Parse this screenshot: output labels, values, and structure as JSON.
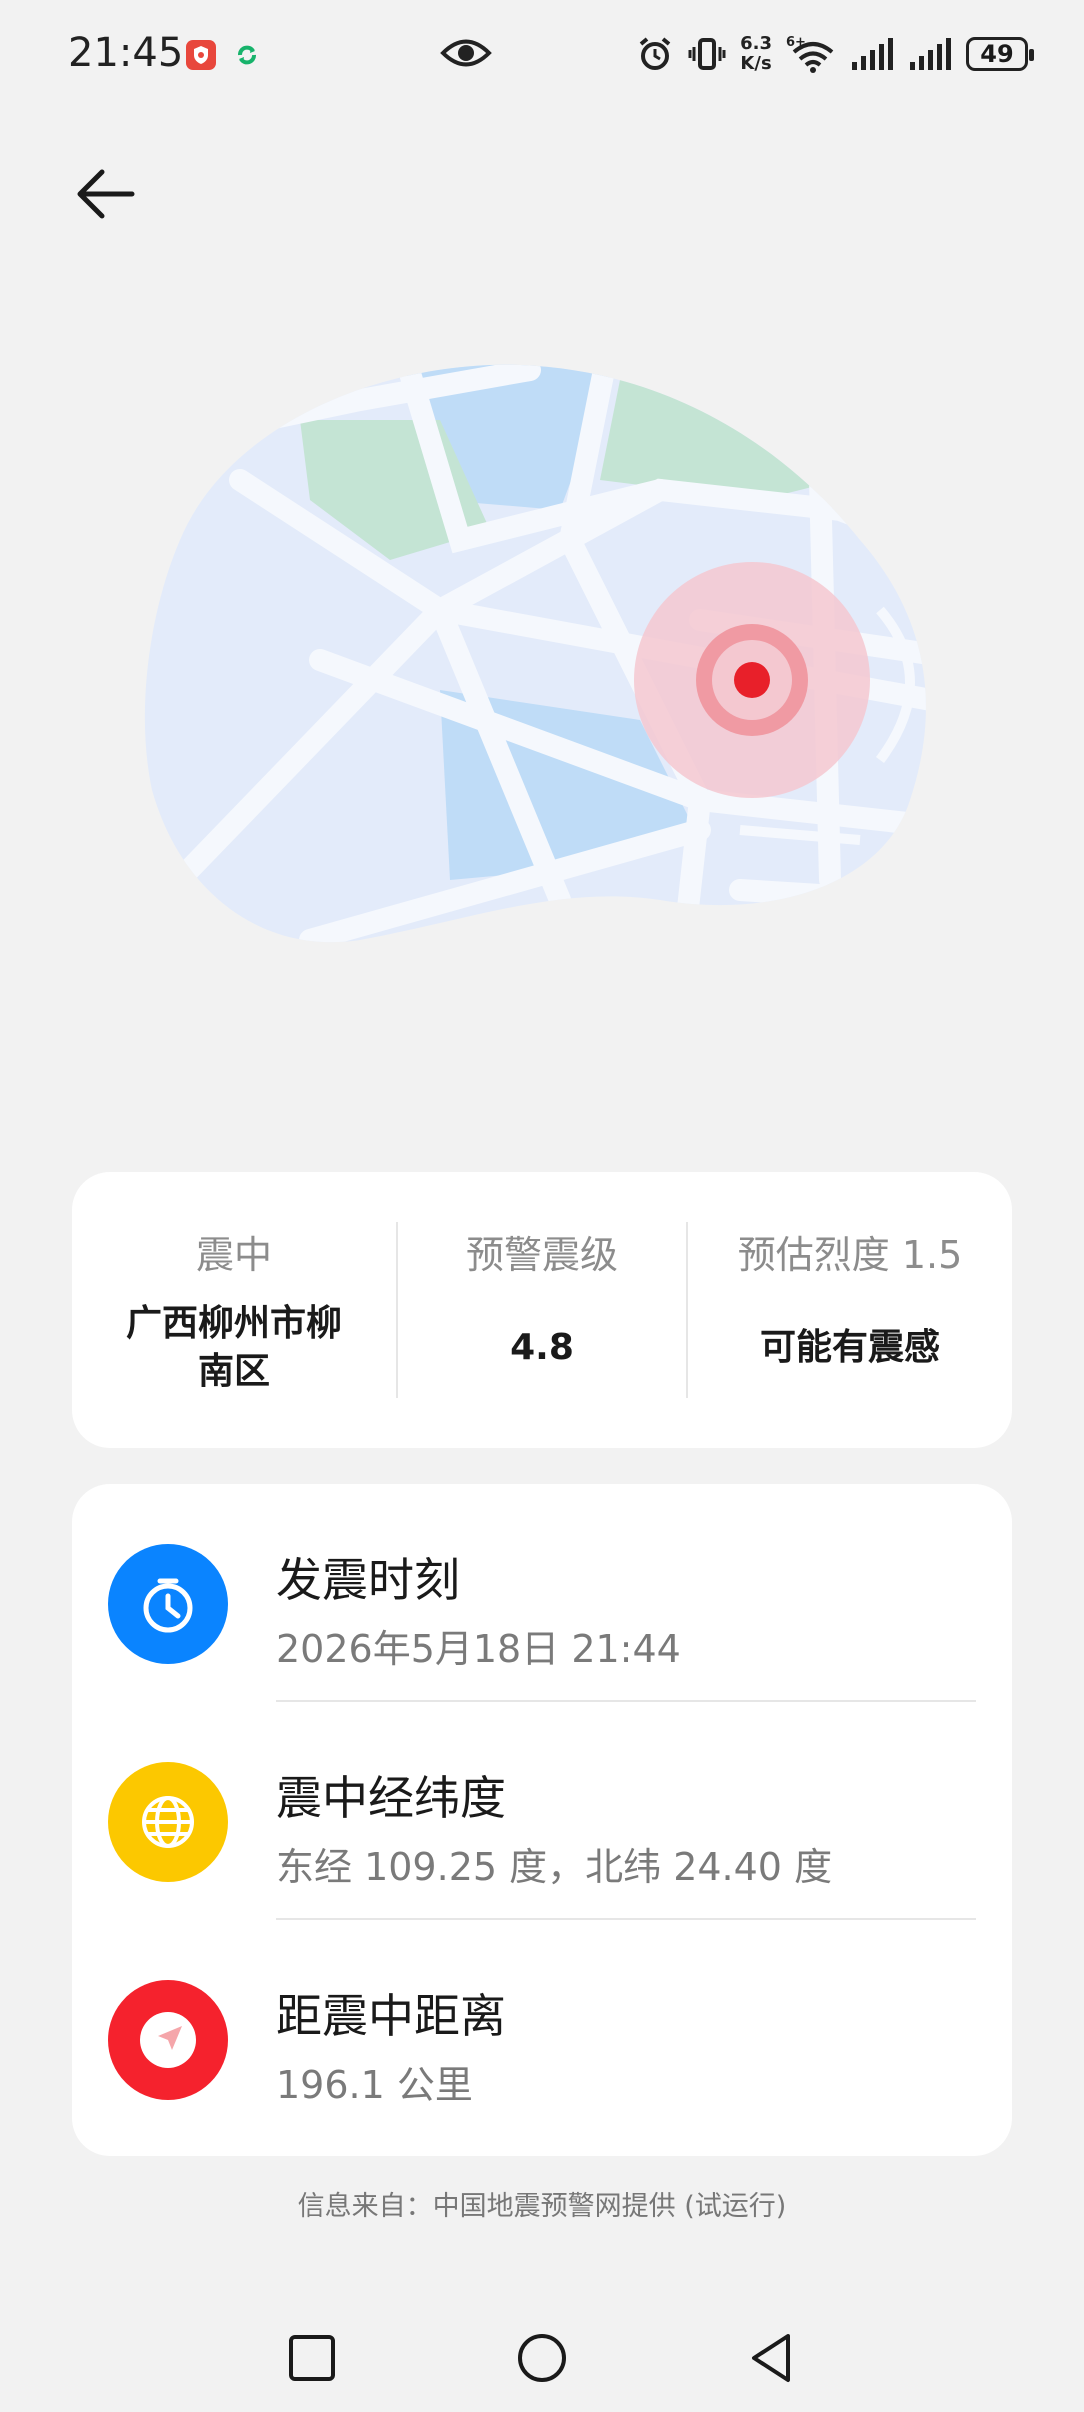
{
  "status_bar": {
    "time": "21:45",
    "net_speed_value": "6.3",
    "net_speed_unit": "K/s",
    "battery": "49",
    "icons": [
      "shield-app-icon",
      "sync-app-icon",
      "eye-icon",
      "alarm-icon",
      "vibrate-icon",
      "wifi-icon",
      "signal-icon",
      "signal-icon",
      "battery-icon"
    ]
  },
  "header": {
    "back_icon": "arrow-left-icon"
  },
  "summary": {
    "epicenter_label": "震中",
    "epicenter_value_line1": "广西柳州市柳",
    "epicenter_value_line2": "南区",
    "magnitude_label": "预警震级",
    "magnitude_value": "4.8",
    "intensity_label": "预估烈度 1.5",
    "intensity_value": "可能有震感"
  },
  "details": [
    {
      "icon": "clock-icon",
      "color": "#0a84ff",
      "title": "发震时刻",
      "value": "2026年5月18日 21:44"
    },
    {
      "icon": "globe-icon",
      "color": "#fcc800",
      "title": "震中经纬度",
      "value": "东经 109.25 度，北纬 24.40 度"
    },
    {
      "icon": "navigation-icon",
      "color": "#f5222d",
      "title": "距震中距离",
      "value": "196.1 公里"
    }
  ],
  "footer": {
    "note": "信息来自：中国地震预警网提供 (试运行)"
  },
  "nav": [
    "recent-apps-icon",
    "home-icon",
    "back-icon"
  ],
  "colors": {
    "background": "#f2f2f2",
    "card": "#ffffff",
    "marker": "#e8202a"
  }
}
